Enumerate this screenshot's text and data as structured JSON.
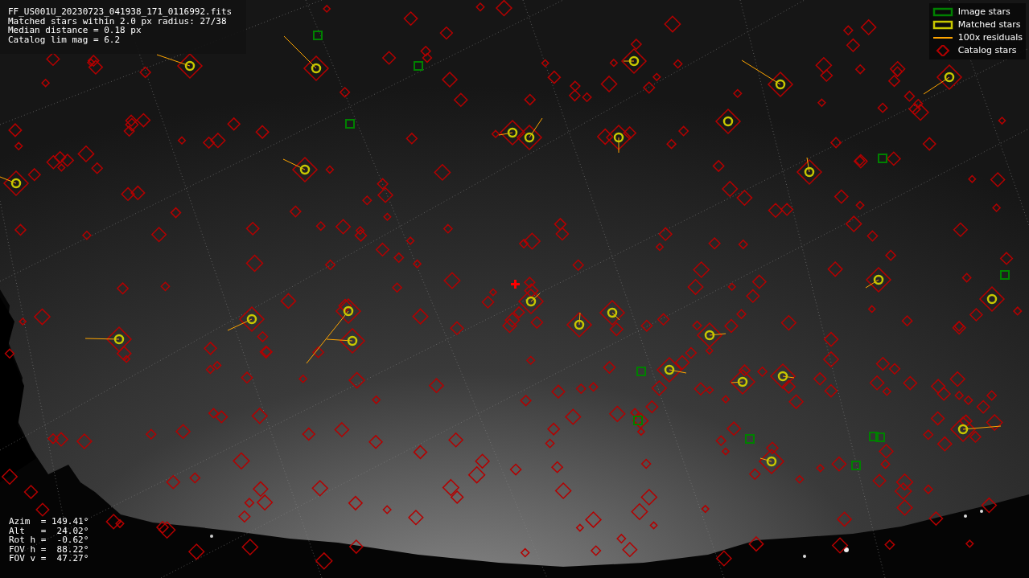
{
  "info_lines": [
    "FF_US001U_20230723_041938_171_0116992.fits",
    "Matched stars within 2.0 px radius: 27/38",
    "Median distance = 0.18 px",
    "Catalog lim mag = 6.2"
  ],
  "legend": [
    {
      "label": "Image stars",
      "color": "#008000"
    },
    {
      "kind": "matched",
      "label": "Matched stars",
      "color": "#c8c800"
    },
    {
      "kind": "residual",
      "label": "100x residuals",
      "color": "#ffa500"
    },
    {
      "kind": "catalog",
      "label": "Catalog stars",
      "color": "#b40000"
    }
  ],
  "pointing_lines": [
    "Azim  = 149.41°",
    "Alt   =  24.02°",
    "Rot h =  -0.62°",
    "FOV h =  88.22°",
    "FOV v =  47.27°"
  ]
}
